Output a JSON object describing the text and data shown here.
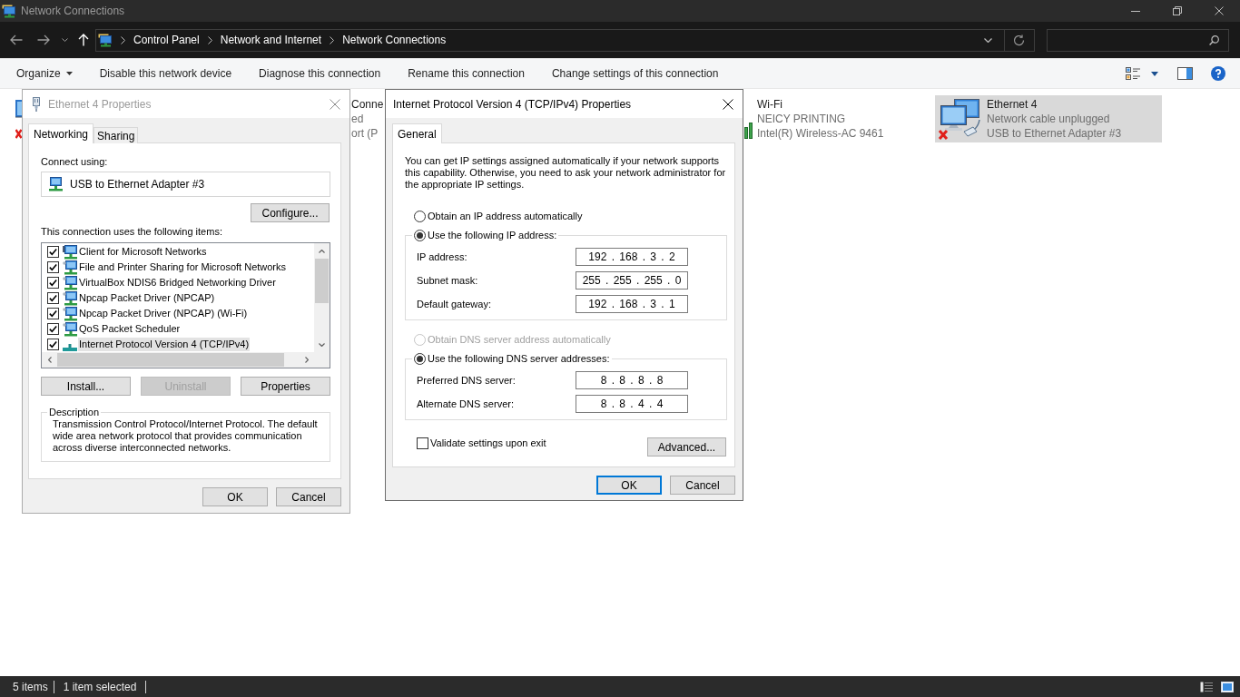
{
  "window": {
    "title": "Network Connections",
    "active": false
  },
  "address_bar": {
    "breadcrumbs": [
      "Control Panel",
      "Network and Internet",
      "Network Connections"
    ]
  },
  "toolbar": {
    "commands": [
      {
        "label": "Organize",
        "has_menu": true
      },
      {
        "label": "Disable this network device",
        "has_menu": false
      },
      {
        "label": "Diagnose this connection",
        "has_menu": false
      },
      {
        "label": "Rename this connection",
        "has_menu": false
      },
      {
        "label": "Change settings of this connection",
        "has_menu": false
      }
    ]
  },
  "connections": [
    {
      "kind": "sliver",
      "selected": false,
      "disconnected": true
    },
    {
      "kind": "fragment",
      "selected": false,
      "name": "Conne",
      "status": "ed",
      "device": "ort (P"
    },
    {
      "kind": "wifi",
      "selected": false,
      "name": "Wi-Fi",
      "status": "NEICY PRINTING",
      "device": "Intel(R) Wireless-AC 9461"
    },
    {
      "kind": "ethernet",
      "selected": true,
      "name": "Ethernet 4",
      "status": "Network cable unplugged",
      "device": "USB to Ethernet Adapter #3",
      "disconnected": true
    }
  ],
  "ethernet_properties": {
    "title": "Ethernet 4 Properties",
    "active": false,
    "tabs": [
      {
        "label": "Networking",
        "selected": true
      },
      {
        "label": "Sharing",
        "selected": false
      }
    ],
    "connect_using_label": "Connect using:",
    "adapter": "USB to Ethernet Adapter #3",
    "configure_button": "Configure...",
    "items_label": "This connection uses the following items:",
    "items": [
      {
        "label": "Client for Microsoft Networks",
        "kind": "client",
        "checked": true,
        "selected": false
      },
      {
        "label": "File and Printer Sharing for Microsoft Networks",
        "kind": "service",
        "checked": true,
        "selected": false
      },
      {
        "label": "VirtualBox NDIS6 Bridged Networking Driver",
        "kind": "service",
        "checked": true,
        "selected": false
      },
      {
        "label": "Npcap Packet Driver (NPCAP)",
        "kind": "service",
        "checked": true,
        "selected": false
      },
      {
        "label": "Npcap Packet Driver (NPCAP) (Wi-Fi)",
        "kind": "service",
        "checked": true,
        "selected": false
      },
      {
        "label": "QoS Packet Scheduler",
        "kind": "service",
        "checked": true,
        "selected": false
      },
      {
        "label": "Internet Protocol Version 4 (TCP/IPv4)",
        "kind": "protocol",
        "checked": true,
        "selected": true
      }
    ],
    "buttons": [
      {
        "label": "Install...",
        "disabled": false
      },
      {
        "label": "Uninstall",
        "disabled": true
      },
      {
        "label": "Properties",
        "disabled": false
      }
    ],
    "description": {
      "label": "Description",
      "text": "Transmission Control Protocol/Internet Protocol. The default wide area network protocol that provides communication across diverse interconnected networks."
    },
    "dialog_buttons": [
      {
        "label": "OK",
        "default": false
      },
      {
        "label": "Cancel",
        "default": false
      }
    ]
  },
  "ipv4_properties": {
    "title": "Internet Protocol Version 4 (TCP/IPv4) Properties",
    "active": true,
    "tabs": [
      {
        "label": "General",
        "selected": true
      }
    ],
    "intro": "You can get IP settings assigned automatically if your network supports this capability. Otherwise, you need to ask your network administrator for the appropriate IP settings.",
    "ip_options": [
      {
        "label": "Obtain an IP address automatically",
        "selected": false,
        "disabled": false
      },
      {
        "label": "Use the following IP address:",
        "selected": true,
        "disabled": false,
        "fields": [
          {
            "label": "IP address:",
            "value": "192 . 168 . 3 . 2"
          },
          {
            "label": "Subnet mask:",
            "value": "255 . 255 . 255 . 0"
          },
          {
            "label": "Default gateway:",
            "value": "192 . 168 . 3 . 1"
          }
        ]
      }
    ],
    "dns_options": [
      {
        "label": "Obtain DNS server address automatically",
        "selected": false,
        "disabled": true
      },
      {
        "label": "Use the following DNS server addresses:",
        "selected": true,
        "disabled": false,
        "fields": [
          {
            "label": "Preferred DNS server:",
            "value": "8 . 8 . 8 . 8"
          },
          {
            "label": "Alternate DNS server:",
            "value": "8 . 8 . 4 . 4"
          }
        ]
      }
    ],
    "validate_on_exit": {
      "label": "Validate settings upon exit",
      "checked": false
    },
    "advanced_button": "Advanced...",
    "dialog_buttons": [
      {
        "label": "OK",
        "default": true
      },
      {
        "label": "Cancel",
        "default": false
      }
    ]
  },
  "status_bar": {
    "item_count": "5 items",
    "selection": "1 item selected"
  }
}
